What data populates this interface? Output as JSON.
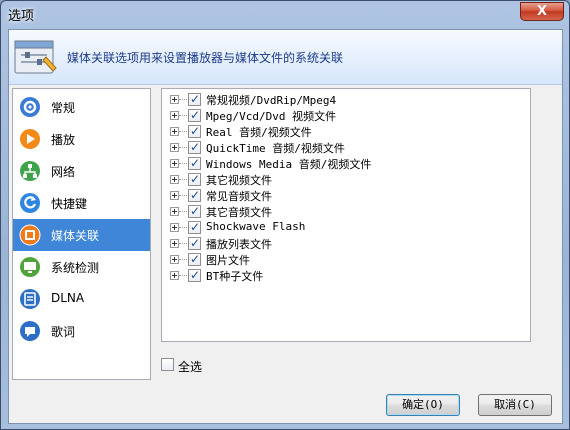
{
  "window": {
    "title": "选项",
    "close_label": "X"
  },
  "banner": {
    "text": "媒体关联选项用来设置播放器与媒体文件的系统关联"
  },
  "sidebar": {
    "items": [
      {
        "label": "常规",
        "icon": "gear-icon",
        "color": "#3a7bd5",
        "active": false
      },
      {
        "label": "播放",
        "icon": "play-icon",
        "color": "#f28a18",
        "active": false
      },
      {
        "label": "网络",
        "icon": "network-icon",
        "color": "#3fa34d",
        "active": false
      },
      {
        "label": "快捷键",
        "icon": "arrow-icon",
        "color": "#2f86e0",
        "active": false
      },
      {
        "label": "媒体关联",
        "icon": "media-icon",
        "color": "#f07b1e",
        "active": true
      },
      {
        "label": "系统检测",
        "icon": "monitor-icon",
        "color": "#50a33a",
        "active": false
      },
      {
        "label": "DLNA",
        "icon": "dlna-icon",
        "color": "#2d6fc6",
        "active": false
      },
      {
        "label": "歌词",
        "icon": "lyrics-icon",
        "color": "#2d6fc6",
        "active": false
      }
    ]
  },
  "tree": {
    "items": [
      {
        "label": "常规视频/DvdRip/Mpeg4",
        "checked": true
      },
      {
        "label": "Mpeg/Vcd/Dvd 视频文件",
        "checked": true
      },
      {
        "label": "Real 音频/视频文件",
        "checked": true
      },
      {
        "label": "QuickTime 音频/视频文件",
        "checked": true
      },
      {
        "label": "Windows Media 音频/视频文件",
        "checked": true
      },
      {
        "label": "其它视频文件",
        "checked": true
      },
      {
        "label": "常见音频文件",
        "checked": true
      },
      {
        "label": "其它音频文件",
        "checked": true
      },
      {
        "label": "Shockwave Flash",
        "checked": true
      },
      {
        "label": "播放列表文件",
        "checked": true
      },
      {
        "label": "图片文件",
        "checked": true
      },
      {
        "label": "BT种子文件",
        "checked": true
      }
    ]
  },
  "select_all": {
    "label": "全选",
    "checked": false
  },
  "buttons": {
    "ok": "确定(O)",
    "cancel": "取消(C)"
  },
  "colors": {
    "accent": "#3f86d8",
    "banner_text": "#1d3c8c"
  }
}
